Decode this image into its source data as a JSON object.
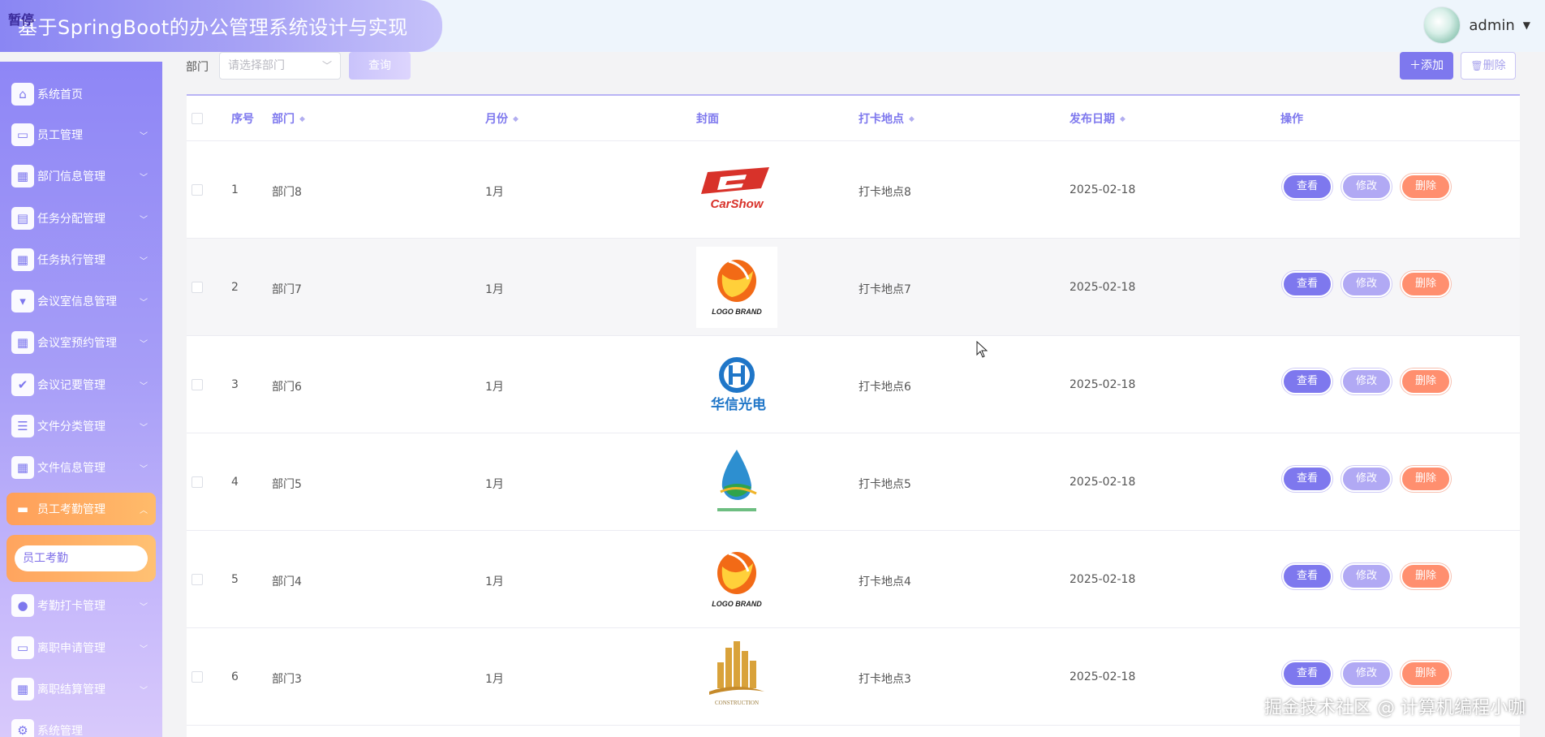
{
  "header": {
    "title": "基于SpringBoot的办公管理系统设计与实现",
    "pause_label": "暂停",
    "user": "admin"
  },
  "sidebar": {
    "items": [
      {
        "label": "系统首页",
        "icon": "home-icon"
      },
      {
        "label": "员工管理",
        "icon": "monitor-icon"
      },
      {
        "label": "部门信息管理",
        "icon": "grid-icon"
      },
      {
        "label": "任务分配管理",
        "icon": "clipboard-icon"
      },
      {
        "label": "任务执行管理",
        "icon": "grid-icon"
      },
      {
        "label": "会议室信息管理",
        "icon": "pin-icon"
      },
      {
        "label": "会议室预约管理",
        "icon": "grid-icon"
      },
      {
        "label": "会议记要管理",
        "icon": "checklist-icon"
      },
      {
        "label": "文件分类管理",
        "icon": "sliders-icon"
      },
      {
        "label": "文件信息管理",
        "icon": "grid-icon"
      },
      {
        "label": "员工考勤管理",
        "icon": "briefcase-icon"
      },
      {
        "label": "考勤打卡管理",
        "icon": "user-icon"
      },
      {
        "label": "离职申请管理",
        "icon": "monitor-icon"
      },
      {
        "label": "离职结算管理",
        "icon": "grid-icon"
      },
      {
        "label": "系统管理",
        "icon": "gear-icon"
      }
    ],
    "submenu_label": "员工考勤"
  },
  "filter": {
    "label": "部门",
    "placeholder": "请选择部门",
    "query_label": "查询",
    "add_label": "添加",
    "delete_label": "删除"
  },
  "table": {
    "columns": [
      "序号",
      "部门",
      "月份",
      "封面",
      "打卡地点",
      "发布日期",
      "操作"
    ],
    "actions": {
      "view": "查看",
      "edit": "修改",
      "delete": "删除"
    },
    "rows": [
      {
        "index": "1",
        "dept": "部门8",
        "month": "1月",
        "cover": "carshow-logo",
        "cover_text": "CarShow",
        "location": "打卡地点8",
        "date": "2025-02-18"
      },
      {
        "index": "2",
        "dept": "部门7",
        "month": "1月",
        "cover": "logo-brand-logo",
        "cover_text": "LOGO BRAND",
        "location": "打卡地点7",
        "date": "2025-02-18"
      },
      {
        "index": "3",
        "dept": "部门6",
        "month": "1月",
        "cover": "huaxin-logo",
        "cover_text": "华信光电",
        "location": "打卡地点6",
        "date": "2025-02-18"
      },
      {
        "index": "4",
        "dept": "部门5",
        "month": "1月",
        "cover": "water-drop-logo",
        "cover_text": "",
        "location": "打卡地点5",
        "date": "2025-02-18"
      },
      {
        "index": "5",
        "dept": "部门4",
        "month": "1月",
        "cover": "logo-brand-logo",
        "cover_text": "LOGO BRAND",
        "location": "打卡地点4",
        "date": "2025-02-18"
      },
      {
        "index": "6",
        "dept": "部门3",
        "month": "1月",
        "cover": "construction-logo",
        "cover_text": "CONSTRUCTION",
        "location": "打卡地点3",
        "date": "2025-02-18"
      }
    ]
  },
  "watermark": "掘金技术社区 @ 计算机编程小咖",
  "colors": {
    "accent": "#7e78ee",
    "danger": "#ff8f6f",
    "active_menu": "#ffa45e"
  }
}
